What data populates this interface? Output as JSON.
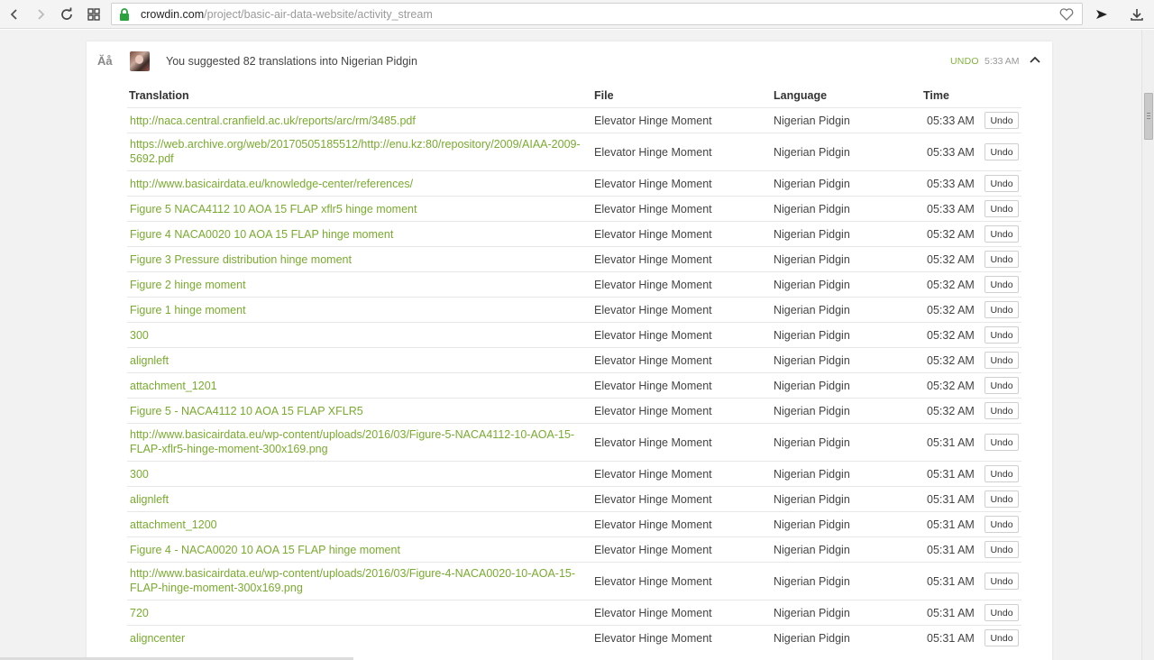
{
  "browser": {
    "url_domain": "crowdin.com",
    "url_path": "/project/basic-air-data-website/activity_stream"
  },
  "activity": {
    "headline": "You suggested 82 translations into Nigerian Pidgin",
    "undo_label": "UNDO",
    "time": "5:33 AM",
    "icon_glyph": "Ăå"
  },
  "table": {
    "headers": {
      "translation": "Translation",
      "file": "File",
      "language": "Language",
      "time": "Time"
    },
    "undo_button_label": "Undo",
    "rows": [
      {
        "translation": "http://naca.central.cranfield.ac.uk/reports/arc/rm/3485.pdf",
        "file": "Elevator Hinge Moment",
        "language": "Nigerian Pidgin",
        "time": "05:33 AM"
      },
      {
        "translation": "https://web.archive.org/web/20170505185512/http://enu.kz:80/repository/2009/AIAA-2009-5692.pdf",
        "file": "Elevator Hinge Moment",
        "language": "Nigerian Pidgin",
        "time": "05:33 AM"
      },
      {
        "translation": "http://www.basicairdata.eu/knowledge-center/references/",
        "file": "Elevator Hinge Moment",
        "language": "Nigerian Pidgin",
        "time": "05:33 AM"
      },
      {
        "translation": "Figure 5 NACA4112 10 AOA 15 FLAP xflr5 hinge moment",
        "file": "Elevator Hinge Moment",
        "language": "Nigerian Pidgin",
        "time": "05:33 AM"
      },
      {
        "translation": "Figure 4 NACA0020 10 AOA 15 FLAP hinge moment",
        "file": "Elevator Hinge Moment",
        "language": "Nigerian Pidgin",
        "time": "05:32 AM"
      },
      {
        "translation": "Figure 3 Pressure distribution hinge moment",
        "file": "Elevator Hinge Moment",
        "language": "Nigerian Pidgin",
        "time": "05:32 AM"
      },
      {
        "translation": "Figure 2 hinge moment",
        "file": "Elevator Hinge Moment",
        "language": "Nigerian Pidgin",
        "time": "05:32 AM"
      },
      {
        "translation": "Figure 1 hinge moment",
        "file": "Elevator Hinge Moment",
        "language": "Nigerian Pidgin",
        "time": "05:32 AM"
      },
      {
        "translation": "300",
        "file": "Elevator Hinge Moment",
        "language": "Nigerian Pidgin",
        "time": "05:32 AM"
      },
      {
        "translation": "alignleft",
        "file": "Elevator Hinge Moment",
        "language": "Nigerian Pidgin",
        "time": "05:32 AM"
      },
      {
        "translation": "attachment_1201",
        "file": "Elevator Hinge Moment",
        "language": "Nigerian Pidgin",
        "time": "05:32 AM"
      },
      {
        "translation": "Figure 5 - NACA4112 10 AOA 15 FLAP XFLR5",
        "file": "Elevator Hinge Moment",
        "language": "Nigerian Pidgin",
        "time": "05:32 AM"
      },
      {
        "translation": "http://www.basicairdata.eu/wp-content/uploads/2016/03/Figure-5-NACA4112-10-AOA-15-FLAP-xflr5-hinge-moment-300x169.png",
        "file": "Elevator Hinge Moment",
        "language": "Nigerian Pidgin",
        "time": "05:31 AM"
      },
      {
        "translation": "300",
        "file": "Elevator Hinge Moment",
        "language": "Nigerian Pidgin",
        "time": "05:31 AM"
      },
      {
        "translation": "alignleft",
        "file": "Elevator Hinge Moment",
        "language": "Nigerian Pidgin",
        "time": "05:31 AM"
      },
      {
        "translation": "attachment_1200",
        "file": "Elevator Hinge Moment",
        "language": "Nigerian Pidgin",
        "time": "05:31 AM"
      },
      {
        "translation": "Figure 4 - NACA0020 10 AOA 15 FLAP hinge moment",
        "file": "Elevator Hinge Moment",
        "language": "Nigerian Pidgin",
        "time": "05:31 AM"
      },
      {
        "translation": "http://www.basicairdata.eu/wp-content/uploads/2016/03/Figure-4-NACA0020-10-AOA-15-FLAP-hinge-moment-300x169.png",
        "file": "Elevator Hinge Moment",
        "language": "Nigerian Pidgin",
        "time": "05:31 AM"
      },
      {
        "translation": "720",
        "file": "Elevator Hinge Moment",
        "language": "Nigerian Pidgin",
        "time": "05:31 AM"
      },
      {
        "translation": "aligncenter",
        "file": "Elevator Hinge Moment",
        "language": "Nigerian Pidgin",
        "time": "05:31 AM"
      }
    ]
  }
}
